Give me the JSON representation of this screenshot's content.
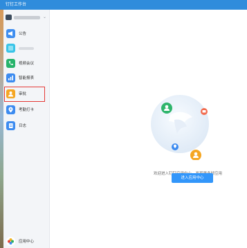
{
  "window": {
    "title": "钉钉工作台"
  },
  "sidebar": {
    "items": [
      {
        "label": "公告",
        "icon": "megaphone-icon",
        "color": "#3f8ef0"
      },
      {
        "label": "",
        "icon": "app-icon",
        "color": "#39c4e8",
        "blurred": true
      },
      {
        "label": "视频会议",
        "icon": "phone-icon",
        "color": "#27b36b"
      },
      {
        "label": "智能报表",
        "icon": "report-icon",
        "color": "#3c8bf0"
      },
      {
        "label": "审批",
        "icon": "person-icon",
        "color": "#f5a623",
        "highlighted": true
      },
      {
        "label": "考勤打卡",
        "icon": "location-pin-icon",
        "color": "#3c8bf0"
      },
      {
        "label": "日志",
        "icon": "log-icon",
        "color": "#3c8bf0"
      }
    ],
    "app_center": {
      "label": "应用中心",
      "icon": "app-center-icon"
    }
  },
  "main": {
    "welcome_text": "欢迎进入钉钉应用中心，发现更多好应用",
    "button_label": "进入应用中心"
  },
  "colors": {
    "titlebar": "#2f8cdc",
    "accent": "#3296fa",
    "highlight_border": "#e53935"
  }
}
